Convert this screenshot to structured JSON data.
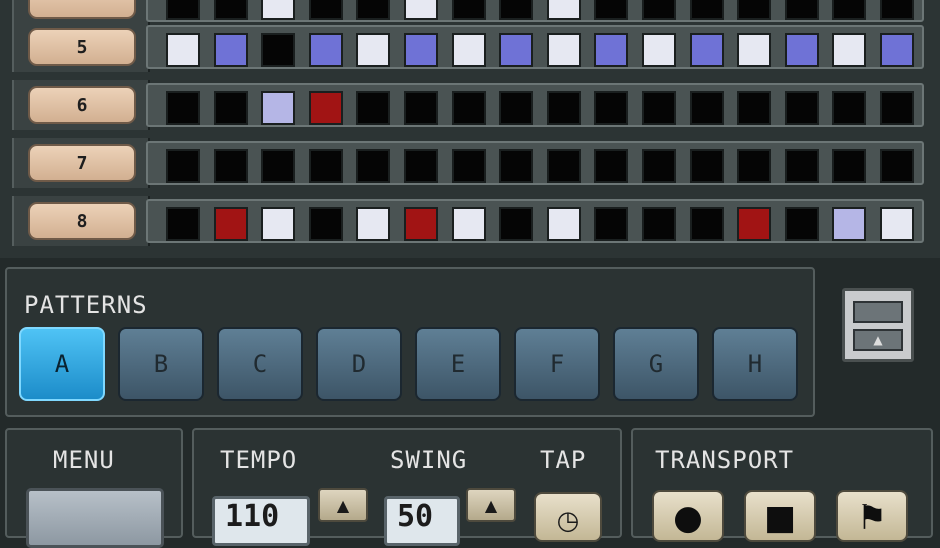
{
  "tracks": [
    {
      "label": "",
      "steps": [
        "off",
        "off",
        "lite",
        "off",
        "off",
        "lite",
        "off",
        "off",
        "lite",
        "off",
        "off",
        "off",
        "off",
        "off",
        "off",
        "off"
      ]
    },
    {
      "label": "5",
      "steps": [
        "lite",
        "blue",
        "off",
        "blue",
        "lite",
        "blue",
        "lite",
        "blue",
        "lite",
        "blue",
        "lite",
        "blue",
        "lite",
        "blue",
        "lite",
        "blue"
      ]
    },
    {
      "label": "6",
      "steps": [
        "off",
        "off",
        "mid",
        "red",
        "off",
        "off",
        "off",
        "off",
        "off",
        "off",
        "off",
        "off",
        "off",
        "off",
        "off",
        "off"
      ]
    },
    {
      "label": "7",
      "steps": [
        "off",
        "off",
        "off",
        "off",
        "off",
        "off",
        "off",
        "off",
        "off",
        "off",
        "off",
        "off",
        "off",
        "off",
        "off",
        "off"
      ]
    },
    {
      "label": "8",
      "steps": [
        "off",
        "red",
        "lite",
        "off",
        "lite",
        "red",
        "lite",
        "off",
        "lite",
        "off",
        "off",
        "off",
        "red",
        "off",
        "mid",
        "lite"
      ]
    }
  ],
  "patterns": {
    "title": "PATTERNS",
    "buttons": [
      "A",
      "B",
      "C",
      "D",
      "E",
      "F",
      "G",
      "H"
    ],
    "active": "A"
  },
  "menu": {
    "title": "MENU"
  },
  "tempo": {
    "title": "TEMPO",
    "value": "110"
  },
  "swing": {
    "title": "SWING",
    "value": "50"
  },
  "tap": {
    "title": "TAP",
    "icon": "clock-icon"
  },
  "transport": {
    "title": "TRANSPORT",
    "buttons": [
      "record",
      "stop",
      "play"
    ]
  },
  "colors": {
    "active": "#1c8cc9",
    "red": "#a11414",
    "blue": "#6f72d6"
  }
}
